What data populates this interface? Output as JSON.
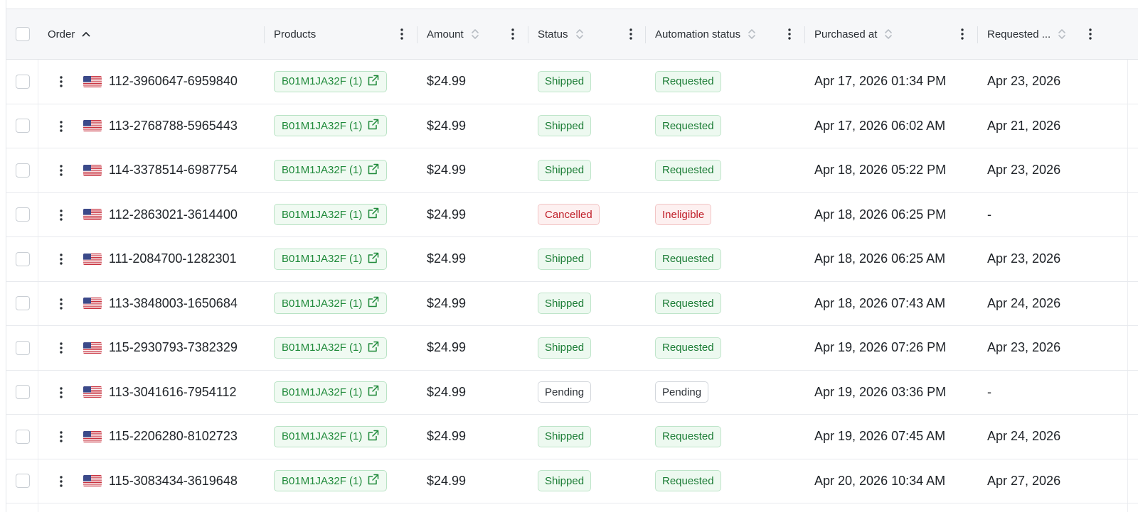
{
  "columns": {
    "order": "Order",
    "products": "Products",
    "amount": "Amount",
    "status": "Status",
    "automation_status": "Automation status",
    "purchased_at": "Purchased at",
    "requested": "Requested ..."
  },
  "icons": {
    "sort_ascending": "chevron-up-icon",
    "sort_neutral": "sort-icon",
    "column_menu": "kebab-icon",
    "row_menu": "kebab-icon",
    "flag": "us-flag-icon",
    "external_link": "external-link-icon"
  },
  "colors": {
    "success": "#1c7d36",
    "danger": "#c0202a",
    "neutral": "#2f343a",
    "header_bg": "#f6f7f9"
  },
  "rows": [
    {
      "order": "112-3960647-6959840",
      "product": "B01M1JA32F (1)",
      "amount": "$24.99",
      "status": "Shipped",
      "status_tone": "green",
      "automation": "Requested",
      "automation_tone": "green",
      "purchased_at": "Apr 17, 2026 01:34 PM",
      "requested": "Apr 23, 2026"
    },
    {
      "order": "113-2768788-5965443",
      "product": "B01M1JA32F (1)",
      "amount": "$24.99",
      "status": "Shipped",
      "status_tone": "green",
      "automation": "Requested",
      "automation_tone": "green",
      "purchased_at": "Apr 17, 2026 06:02 AM",
      "requested": "Apr 21, 2026"
    },
    {
      "order": "114-3378514-6987754",
      "product": "B01M1JA32F (1)",
      "amount": "$24.99",
      "status": "Shipped",
      "status_tone": "green",
      "automation": "Requested",
      "automation_tone": "green",
      "purchased_at": "Apr 18, 2026 05:22 PM",
      "requested": "Apr 23, 2026"
    },
    {
      "order": "112-2863021-3614400",
      "product": "B01M1JA32F (1)",
      "amount": "$24.99",
      "status": "Cancelled",
      "status_tone": "red",
      "automation": "Ineligible",
      "automation_tone": "red",
      "purchased_at": "Apr 18, 2026 06:25 PM",
      "requested": "-"
    },
    {
      "order": "111-2084700-1282301",
      "product": "B01M1JA32F (1)",
      "amount": "$24.99",
      "status": "Shipped",
      "status_tone": "green",
      "automation": "Requested",
      "automation_tone": "green",
      "purchased_at": "Apr 18, 2026 06:25 AM",
      "requested": "Apr 23, 2026"
    },
    {
      "order": "113-3848003-1650684",
      "product": "B01M1JA32F (1)",
      "amount": "$24.99",
      "status": "Shipped",
      "status_tone": "green",
      "automation": "Requested",
      "automation_tone": "green",
      "purchased_at": "Apr 18, 2026 07:43 AM",
      "requested": "Apr 24, 2026"
    },
    {
      "order": "115-2930793-7382329",
      "product": "B01M1JA32F (1)",
      "amount": "$24.99",
      "status": "Shipped",
      "status_tone": "green",
      "automation": "Requested",
      "automation_tone": "green",
      "purchased_at": "Apr 19, 2026 07:26 PM",
      "requested": "Apr 23, 2026"
    },
    {
      "order": "113-3041616-7954112",
      "product": "B01M1JA32F (1)",
      "amount": "$24.99",
      "status": "Pending",
      "status_tone": "gray",
      "automation": "Pending",
      "automation_tone": "gray",
      "purchased_at": "Apr 19, 2026 03:36 PM",
      "requested": "-"
    },
    {
      "order": "115-2206280-8102723",
      "product": "B01M1JA32F (1)",
      "amount": "$24.99",
      "status": "Shipped",
      "status_tone": "green",
      "automation": "Requested",
      "automation_tone": "green",
      "purchased_at": "Apr 19, 2026 07:45 AM",
      "requested": "Apr 24, 2026"
    },
    {
      "order": "115-3083434-3619648",
      "product": "B01M1JA32F (1)",
      "amount": "$24.99",
      "status": "Shipped",
      "status_tone": "green",
      "automation": "Requested",
      "automation_tone": "green",
      "purchased_at": "Apr 20, 2026 10:34 AM",
      "requested": "Apr 27, 2026"
    }
  ]
}
